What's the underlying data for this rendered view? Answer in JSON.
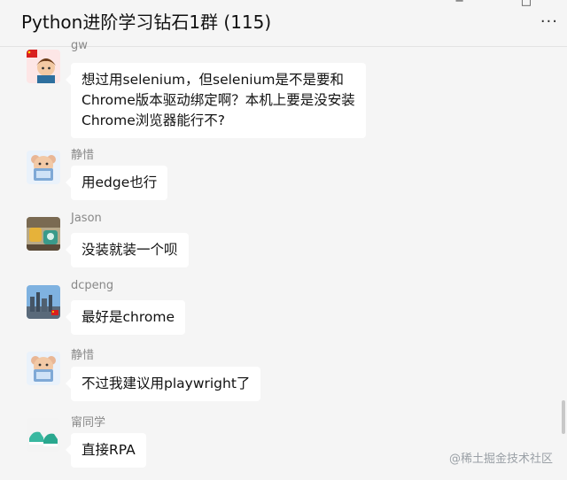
{
  "window": {
    "title": "Python进阶学习钻石1群 (115)",
    "more_icon": "···",
    "min_icon": "−",
    "max_icon": "□"
  },
  "messages": [
    {
      "sender": "gw",
      "text_lines": [
        "想过用selenium，但selenium是不是要和",
        "Chrome版本驱动绑定啊？本机上要是没安装",
        "Chrome浏览器能行不?"
      ],
      "avatar": "cartoon-person-avatar"
    },
    {
      "sender": "静惜",
      "text": "用edge也行",
      "avatar": "cartoon-bear-avatar"
    },
    {
      "sender": "Jason",
      "text": "没装就装一个呗",
      "avatar": "toys-photo-avatar"
    },
    {
      "sender": "dcpeng",
      "text": "最好是chrome",
      "avatar": "city-skyline-avatar"
    },
    {
      "sender": "静惜",
      "text": "不过我建议用playwright了",
      "avatar": "cartoon-bear-avatar"
    },
    {
      "sender": "甯同学",
      "text": "直接RPA",
      "avatar": "green-shoes-avatar"
    }
  ],
  "watermark": "@稀土掘金技术社区"
}
